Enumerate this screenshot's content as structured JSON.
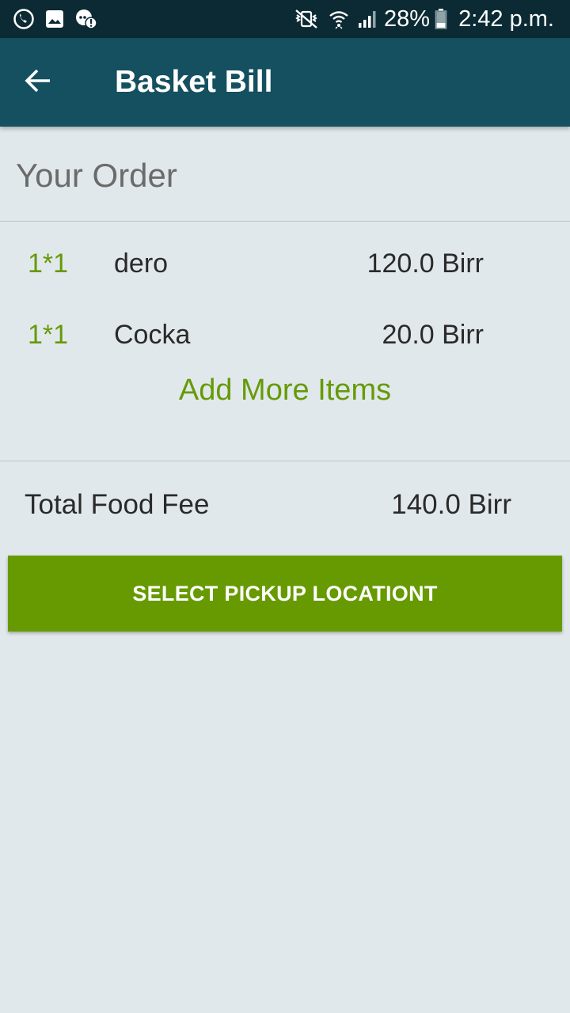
{
  "status_bar": {
    "icons_left": [
      "phone-call-icon",
      "image-icon",
      "alert-chat-icon"
    ],
    "icons_right": [
      "vibrate-mute-icon",
      "wifi-icon",
      "signal-icon",
      "battery-icon"
    ],
    "battery": "28%",
    "time": "2:42 p.m."
  },
  "app_bar": {
    "back_icon": "arrow-left-icon",
    "title": "Basket Bill",
    "background": "#14505f"
  },
  "order": {
    "title": "Your Order",
    "items": [
      {
        "qty": "1*1",
        "name": "dero",
        "price": "120.0 Birr"
      },
      {
        "qty": "1*1",
        "name": "Cocka",
        "price": "20.0 Birr"
      }
    ],
    "add_more_label": "Add More Items"
  },
  "total": {
    "label": "Total Food Fee",
    "value": "140.0 Birr"
  },
  "pickup_button": {
    "label": "SELECT PICKUP LOCATIONT",
    "color": "#669a00"
  },
  "accent_color": "#669a08"
}
